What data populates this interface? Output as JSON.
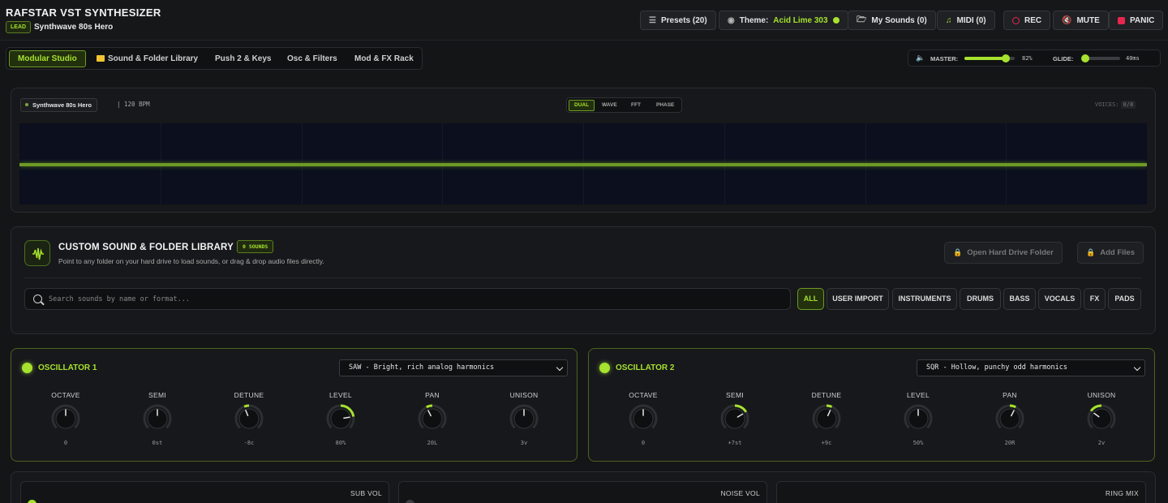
{
  "header": {
    "app_title": "RAFSTAR VST SYNTHESIZER",
    "category_badge": "LEAD",
    "patch_name": "Synthwave 80s Hero",
    "buttons": {
      "presets": "Presets (20)",
      "theme_label": "Theme:",
      "theme_value": "Acid Lime 303",
      "my_sounds": "My Sounds (0)",
      "midi": "MIDI (0)",
      "rec": "REC",
      "mute": "MUTE",
      "panic": "PANIC"
    }
  },
  "nav": {
    "tabs": [
      {
        "label": "Modular Studio",
        "active": true
      },
      {
        "label": "Sound & Folder Library",
        "active": false
      },
      {
        "label": "Push 2 & Keys",
        "active": false
      },
      {
        "label": "Osc & Filters",
        "active": false
      },
      {
        "label": "Mod & FX Rack",
        "active": false
      }
    ]
  },
  "master": {
    "master_label": "MASTER:",
    "master_value": "82%",
    "master_level": 0.82,
    "glide_label": "GLIDE:",
    "glide_value": "40ms",
    "glide_level": 0.08
  },
  "scope": {
    "patch_tag": "Synthwave 80s Hero",
    "bpm": "| 120 BPM",
    "modes": [
      "DUAL",
      "WAVE",
      "FFT",
      "PHASE"
    ],
    "active_mode": "DUAL",
    "voices_label": "VOICES:",
    "voices_value": "0/8"
  },
  "library": {
    "title": "CUSTOM SOUND & FOLDER LIBRARY",
    "badge": "0 SOUNDS",
    "subtitle": "Point to any folder on your hard drive to load sounds, or drag & drop audio files directly.",
    "open_folder": "Open Hard Drive Folder",
    "add_files": "Add Files",
    "search_placeholder": "Search sounds by name or format...",
    "filters": [
      "ALL",
      "USER IMPORT",
      "INSTRUMENTS",
      "DRUMS",
      "BASS",
      "VOCALS",
      "FX",
      "PADS"
    ],
    "active_filter": "ALL"
  },
  "oscillators": [
    {
      "title": "OSCILLATOR 1",
      "waveform": "SAW - Bright, rich analog harmonics",
      "knobs": [
        {
          "label": "OCTAVE",
          "value": "0",
          "amount": 0.5
        },
        {
          "label": "SEMI",
          "value": "0st",
          "amount": 0.5
        },
        {
          "label": "DETUNE",
          "value": "-8c",
          "amount": 0.42
        },
        {
          "label": "LEVEL",
          "value": "80%",
          "amount": 0.8
        },
        {
          "label": "PAN",
          "value": "20L",
          "amount": 0.4
        },
        {
          "label": "UNISON",
          "value": "3v",
          "amount": 0.5
        }
      ]
    },
    {
      "title": "OSCILLATOR 2",
      "waveform": "SQR - Hollow, punchy odd harmonics",
      "knobs": [
        {
          "label": "OCTAVE",
          "value": "0",
          "amount": 0.5
        },
        {
          "label": "SEMI",
          "value": "+7st",
          "amount": 0.72
        },
        {
          "label": "DETUNE",
          "value": "+9c",
          "amount": 0.59
        },
        {
          "label": "LEVEL",
          "value": "50%",
          "amount": 0.5
        },
        {
          "label": "PAN",
          "value": "20R",
          "amount": 0.6
        },
        {
          "label": "UNISON",
          "value": "2v",
          "amount": 0.3
        }
      ]
    }
  ],
  "bottom": {
    "sub_vol": "SUB VOL",
    "noise_vol": "NOISE VOL",
    "ring_mix": "RING MIX"
  },
  "colors": {
    "accent": "#a6e22e",
    "panic": "#e8264f",
    "background": "#141517"
  }
}
